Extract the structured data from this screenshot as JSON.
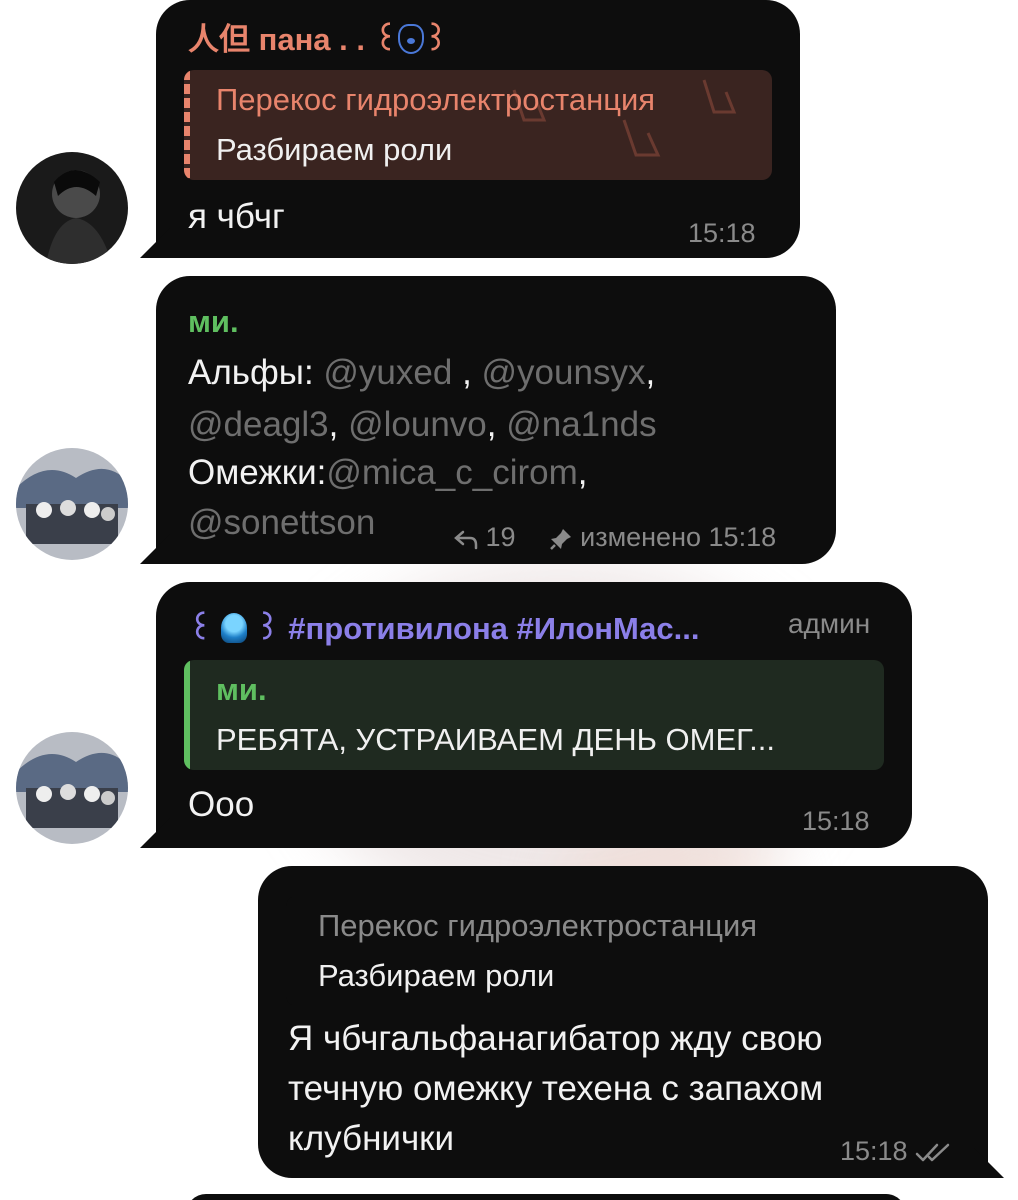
{
  "messages": [
    {
      "sender": "人但 пана . . ꒰",
      "sender_suffix": "꒱",
      "sender_color": "#e8846c",
      "quote": {
        "title": "Перекос гидроэлектростанция",
        "text": "Разбираем роли",
        "color": "#e8846c"
      },
      "text": "я чбчг",
      "time": "15:18"
    },
    {
      "sender": "ми.",
      "sender_color": "#5fbf60",
      "lines": [
        [
          {
            "t": "Альфы: ",
            "m": false
          },
          {
            "t": "@yuxed",
            "m": true
          },
          {
            "t": " , ",
            "m": false
          },
          {
            "t": "@younsyx",
            "m": true
          },
          {
            "t": ",",
            "m": false
          }
        ],
        [
          {
            "t": "@deagl3",
            "m": true
          },
          {
            "t": ", ",
            "m": false
          },
          {
            "t": "@lounvo",
            "m": true
          },
          {
            "t": ", ",
            "m": false
          },
          {
            "t": "@na1nds",
            "m": true
          }
        ],
        [
          {
            "t": "Омежки:",
            "m": false
          },
          {
            "t": "@mica_c_cirom",
            "m": true
          },
          {
            "t": ",",
            "m": false
          }
        ],
        [
          {
            "t": "@sonettson",
            "m": true
          }
        ]
      ],
      "replies_count": "19",
      "edited_label": "изменено",
      "time": "15:18"
    },
    {
      "sender_prefix": "꒰",
      "sender": "꒱ #противилона #ИлонМас...",
      "sender_color": "#8b7fe8",
      "role": "админ",
      "quote": {
        "title": "ми.",
        "text": "РЕБЯТА, УСТРАИВАЕМ ДЕНЬ ОМЕГ...",
        "color": "#5fbf60"
      },
      "text": "Ооо",
      "time": "15:18"
    },
    {
      "quote": {
        "title": "Перекос гидроэлектростанция",
        "text": "Разбираем роли"
      },
      "lines": [
        "Я чбчгальфанагибатор жду свою",
        "течную омежку техена с запахом",
        "клубнички"
      ],
      "time": "15:18"
    }
  ],
  "colors": {
    "bubble": "#0d0d0d",
    "mention": "#6e6e6e",
    "time": "#8a8a8a"
  },
  "icons": [
    "hamsa-emoji-icon",
    "jellyfish-emoji-icon",
    "reply-arrow-icon",
    "pin-icon",
    "double-check-icon"
  ]
}
